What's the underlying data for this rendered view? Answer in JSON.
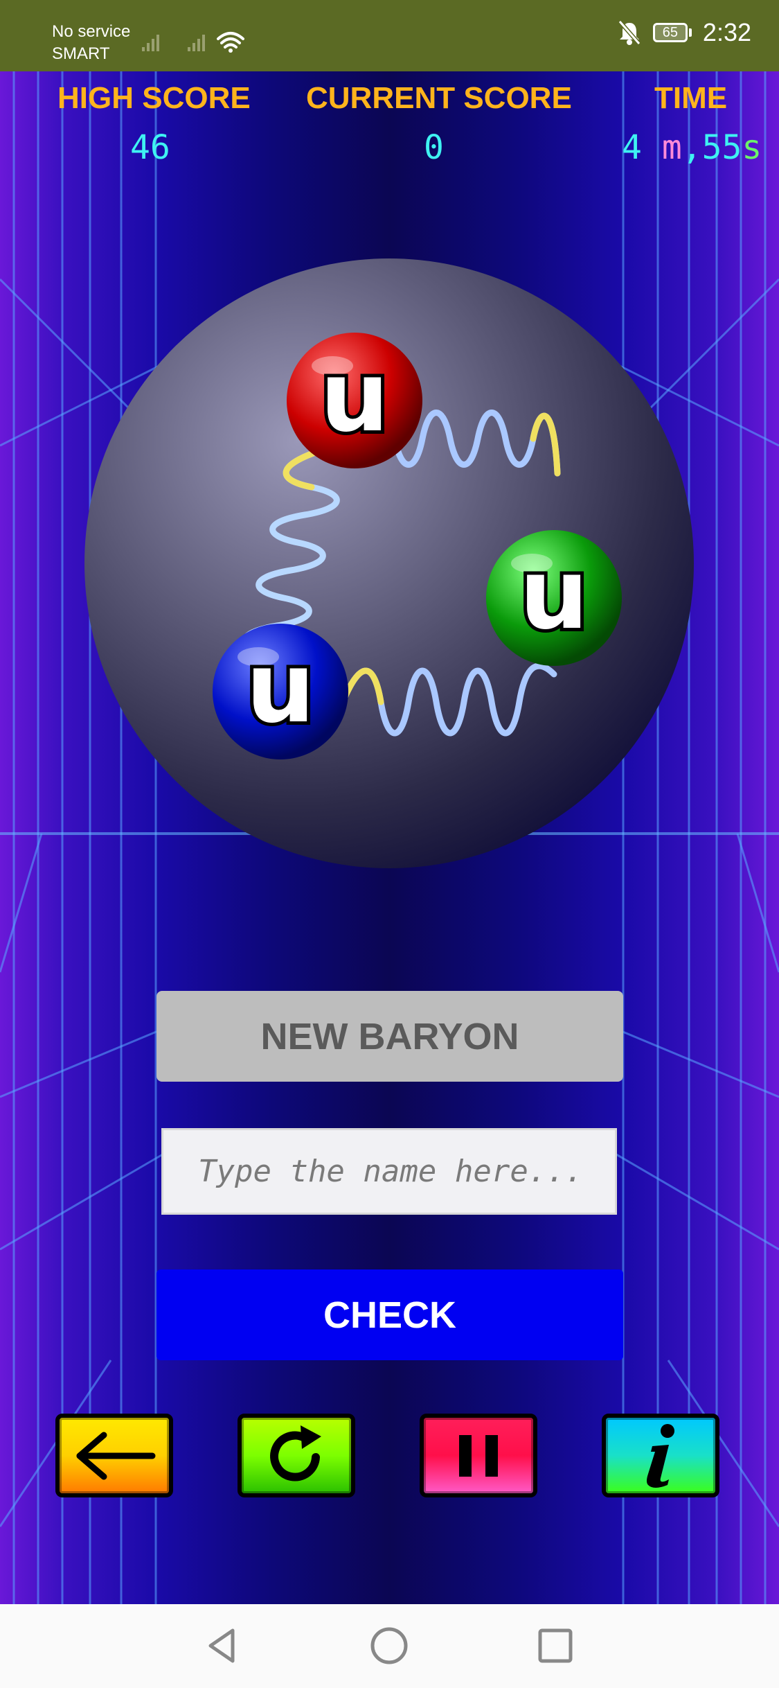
{
  "status_bar": {
    "carrier_line1": "No service",
    "carrier_line2": "SMART",
    "battery": "65",
    "time": "2:32",
    "icons": [
      "signal-icon",
      "signal-icon",
      "wifi-icon",
      "bell-off-icon",
      "battery-icon"
    ]
  },
  "scores": {
    "high_score_label": "HIGH SCORE",
    "high_score_value": "46",
    "current_score_label": "CURRENT SCORE",
    "current_score_value": "0",
    "time_label": "TIME",
    "time_minutes": "4",
    "time_minutes_unit": "m",
    "time_separator": ",",
    "time_seconds": "55",
    "time_seconds_unit": "s"
  },
  "baryon": {
    "quarks": [
      {
        "label": "u",
        "color": "#cc0000"
      },
      {
        "label": "u",
        "color": "#0a9a0a"
      },
      {
        "label": "u",
        "color": "#0010c8"
      }
    ]
  },
  "controls": {
    "new_baryon_label": "NEW BARYON",
    "name_placeholder": "Type the name here...",
    "check_label": "CHECK"
  },
  "toolbar": {
    "icons": [
      "back-arrow-icon",
      "restart-icon",
      "pause-icon",
      "info-icon"
    ],
    "colors": {
      "back": "#ffd000",
      "restart": "#7dff00",
      "pause": "#ff1f5a",
      "info": "#00c8ff"
    }
  },
  "nav_bar": {
    "icons": [
      "back-triangle-icon",
      "home-circle-icon",
      "recents-square-icon"
    ]
  }
}
